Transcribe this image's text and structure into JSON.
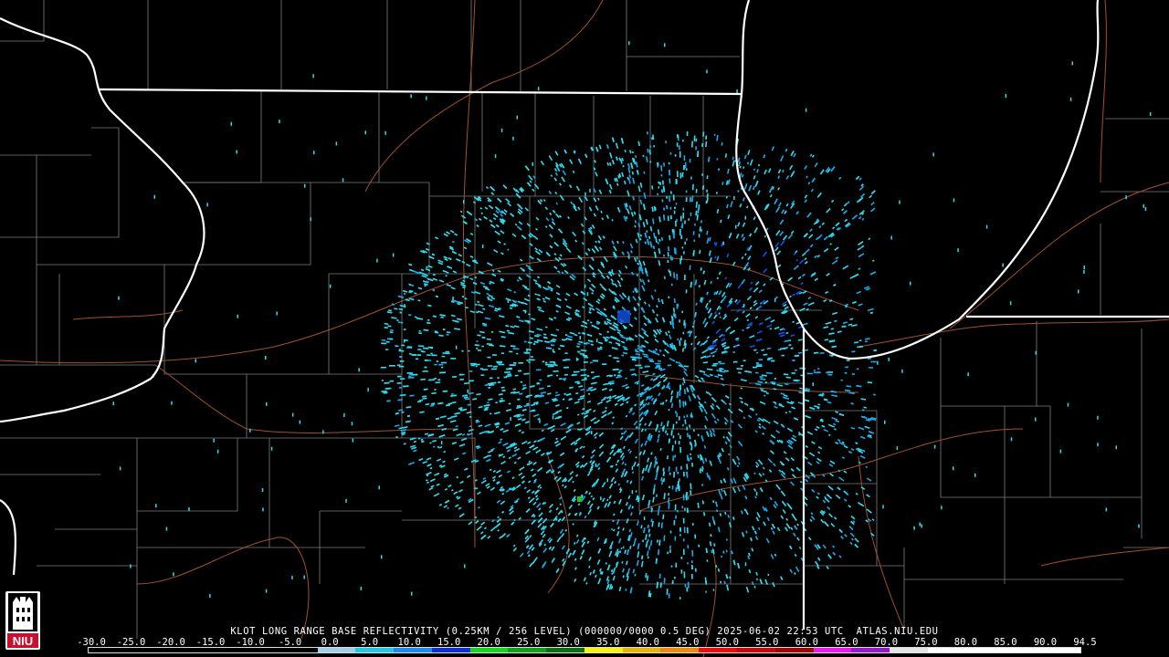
{
  "caption": "KLOT LONG RANGE BASE REFLECTIVITY (0.25KM / 256 LEVEL) (000000/0000 0.5 DEG) 2025-06-02 22:53 UTC  ATLAS.NIU.EDU",
  "scale": {
    "labels": [
      "-30.0",
      "-25.0",
      "-20.0",
      "-15.0",
      "-10.0",
      "-5.0",
      "0.0",
      "5.0",
      "10.0",
      "15.0",
      "20.0",
      "25.0",
      "30.0",
      "35.0",
      "40.0",
      "45.0",
      "50.0",
      "55.0",
      "60.0",
      "65.0",
      "70.0",
      "75.0",
      "80.0",
      "85.0",
      "90.0",
      "94.5"
    ],
    "colors": [
      "#000000",
      "#000000",
      "#000000",
      "#000000",
      "#000000",
      "#000000",
      "#9ed0e8",
      "#1ec8e6",
      "#1a8cf0",
      "#0a2fd8",
      "#12d81a",
      "#0ea016",
      "#0a700e",
      "#f7f206",
      "#e8b406",
      "#f08a06",
      "#f00a0a",
      "#c80808",
      "#a00404",
      "#f018f0",
      "#9818d0",
      "#e6e6e6",
      "#ffffff",
      "#ffffff",
      "#ffffff",
      "#ffffff"
    ]
  },
  "logo": {
    "text": "NIU"
  },
  "map": {
    "radar_colors": {
      "light": "#2cdcf0",
      "mid": "#1aa8e8",
      "deep": "#1450e0",
      "green": "#22c020"
    },
    "line_colors": {
      "state": "#ffffff",
      "county": "#8a8a8a",
      "road": "#a0522d"
    }
  }
}
